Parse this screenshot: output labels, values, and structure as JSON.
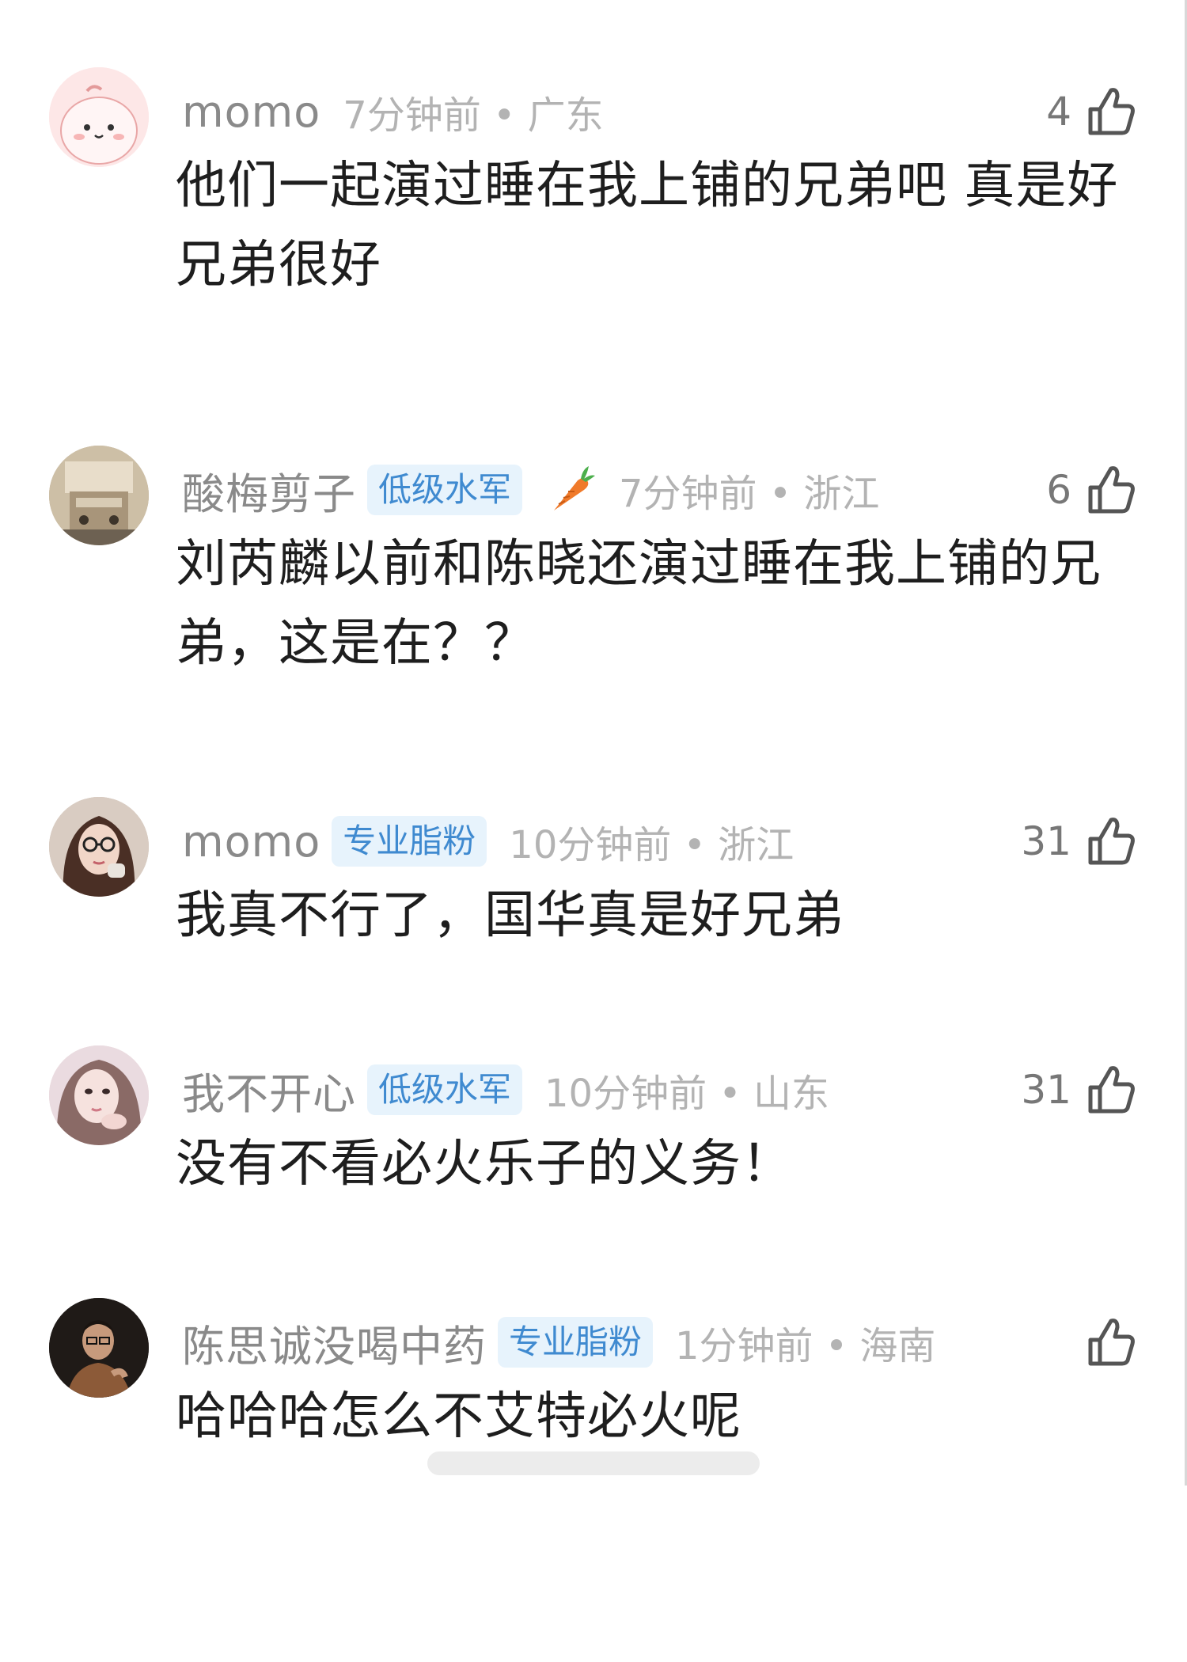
{
  "comments": [
    {
      "username": "momo",
      "badge": "",
      "time": "7分钟前",
      "location": "广东",
      "likes": "4",
      "text": "他们一起演过睡在我上铺的兄弟吧 真是好兄弟很好",
      "avatar": "pink-cartoon-avatar"
    },
    {
      "username": "酸梅剪子",
      "badge": "低级水军",
      "badge_icon": "carrot-icon",
      "time": "7分钟前",
      "location": "浙江",
      "likes": "6",
      "text": "刘芮麟以前和陈晓还演过睡在我上铺的兄弟，这是在？？",
      "avatar": "photo-avatar-boxes"
    },
    {
      "username": "momo",
      "badge": "专业脂粉",
      "time": "10分钟前",
      "location": "浙江",
      "likes": "31",
      "text": "我真不行了，国华真是好兄弟",
      "avatar": "photo-avatar-glasses-girl"
    },
    {
      "username": "我不开心",
      "badge": "低级水军",
      "time": "10分钟前",
      "location": "山东",
      "likes": "31",
      "text": "没有不看必火乐子的义务！",
      "avatar": "photo-avatar-girl"
    },
    {
      "username": "陈思诚没喝中药",
      "badge": "专业脂粉",
      "time": "1分钟前",
      "location": "海南",
      "likes": "",
      "text": "哈哈哈怎么不艾特必火呢",
      "avatar": "photo-avatar-man-dark"
    }
  ],
  "separator": "•",
  "colors": {
    "username": "#8a8a8a",
    "meta": "#b3b3b3",
    "badge_bg": "#e7f3fc",
    "badge_text": "#3f8ad0",
    "text": "#1e1e1e"
  }
}
